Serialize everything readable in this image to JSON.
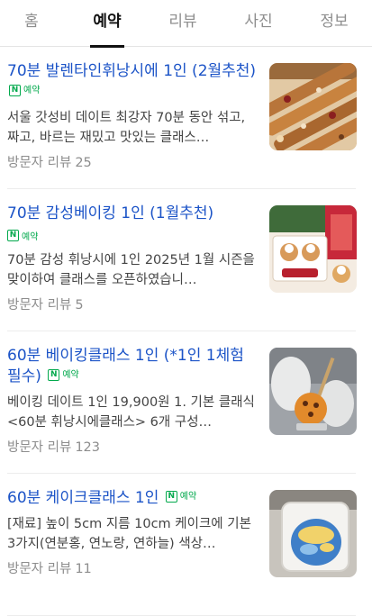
{
  "tabs": [
    {
      "label": "홈",
      "active": false
    },
    {
      "label": "예약",
      "active": true
    },
    {
      "label": "리뷰",
      "active": false
    },
    {
      "label": "사진",
      "active": false
    },
    {
      "label": "정보",
      "active": false
    }
  ],
  "items": [
    {
      "title": "70분 발렌타인휘낭시에 1인 (2월추천)",
      "badge": {
        "icon": "naver-n-icon",
        "label": "예약"
      },
      "description": "서울 갓성비 데이트 최강자 70분 동안 섞고, 짜고, 바르는 재밌고 맛있는 클래스…",
      "visitor_label": "방문자 리뷰",
      "review_count": "25",
      "thumbnail": "financier-pastries-photo"
    },
    {
      "title": "70분 감성베이킹 1인 (1월추천)",
      "badge": {
        "icon": "naver-n-icon",
        "label": "예약"
      },
      "description": "70분 감성 휘낭시에 1인 2025년 1월 시즌을 맞이하여 클래스를 오픈하였습니…",
      "visitor_label": "방문자 리뷰",
      "review_count": "5",
      "thumbnail": "snowman-baking-photo"
    },
    {
      "title": "60분 베이킹클래스 1인 (*1인 1체험 필수)",
      "badge": {
        "icon": "naver-n-icon",
        "label": "예약"
      },
      "description": "베이킹 데이트 1인 19,900원 1. 기본 클래식 <60분 휘낭시에클래스> 6개 구성…",
      "visitor_label": "방문자 리뷰",
      "review_count": "123",
      "thumbnail": "glaze-piping-photo"
    },
    {
      "title": "60분 케이크클래스 1인",
      "badge": {
        "icon": "naver-n-icon",
        "label": "예약"
      },
      "description": "[재료] 높이 5cm 지름 10cm 케이크에 기본 3가지(연분홍, 연노랑, 연하늘) 색상…",
      "visitor_label": "방문자 리뷰",
      "review_count": "11",
      "thumbnail": "mini-cake-box-photo"
    }
  ],
  "colors": {
    "title_blue": "#1b53c7",
    "naver_green": "#03a94d",
    "meta_gray": "#8d8d8d",
    "active_tab": "#111111"
  }
}
